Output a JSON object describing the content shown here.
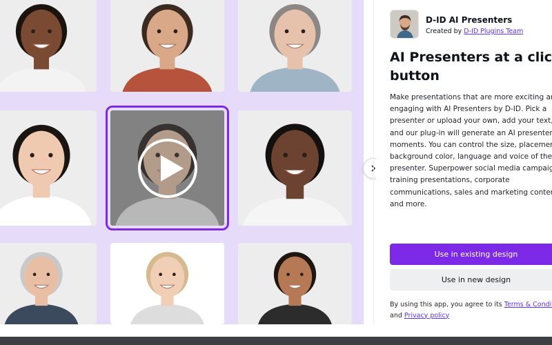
{
  "app": {
    "name": "D-ID AI Presenters",
    "created_by_prefix": "Created by ",
    "created_by_link": "D-ID Plugins Team"
  },
  "headline": {
    "line1": "AI Presenters at a click of a",
    "line2": "button"
  },
  "description": {
    "lines": [
      "Make presentations that are more exciting and",
      "engaging with AI Presenters by D-ID. Pick a",
      "presenter or upload your own, add your text,",
      "and our plug-in will generate an AI presenter in",
      "moments. You can control the size, placement,",
      "background color, language and voice of the",
      "presenter. Superpower social media campaigns,",
      "training presentations, corporate",
      "communications, sales and marketing content",
      "and more."
    ]
  },
  "buttons": {
    "primary": "Use in existing design",
    "secondary": "Use in new design"
  },
  "terms": {
    "prefix": "By using this app, you agree to its ",
    "terms_link": "Terms & Conditions",
    "middle": "and ",
    "privacy_link": "Privacy policy"
  },
  "gallery": {
    "selected_index": 4,
    "presenters": [
      {
        "skin": "#7a4a33",
        "hair": "#1c130f",
        "shirt": "#f3f3f3",
        "bg": "#ededed"
      },
      {
        "skin": "#d8a888",
        "hair": "#3a2a20",
        "shirt": "#b5533c",
        "bg": "#ededed"
      },
      {
        "skin": "#e6c2ac",
        "hair": "#8c8784",
        "shirt": "#9fb4c4",
        "bg": "#ededed"
      },
      {
        "skin": "#efcab0",
        "hair": "#1a1412",
        "shirt": "#ffffff",
        "bg": "#ededed"
      },
      {
        "skin": "#e9c3a7",
        "hair": "#231a16",
        "shirt": "#f2f2f2",
        "bg": "#9b9b9b"
      },
      {
        "skin": "#6b4330",
        "hair": "#141010",
        "shirt": "#f5f5f5",
        "bg": "#ededed"
      },
      {
        "skin": "#e8bfa5",
        "hair": "#c9c9c9",
        "shirt": "#3b4a5c",
        "bg": "#ededed"
      },
      {
        "skin": "#f0cfb6",
        "hair": "#d7b98f",
        "shirt": "#dddddd",
        "bg": "#ffffff"
      },
      {
        "skin": "#b57a55",
        "hair": "#1f1612",
        "shirt": "#2c2c2c",
        "bg": "#ededed"
      }
    ]
  },
  "colors": {
    "accent": "#7d2ae8",
    "link": "#5a32fa",
    "gallery_bg": "#e6dcfa"
  }
}
